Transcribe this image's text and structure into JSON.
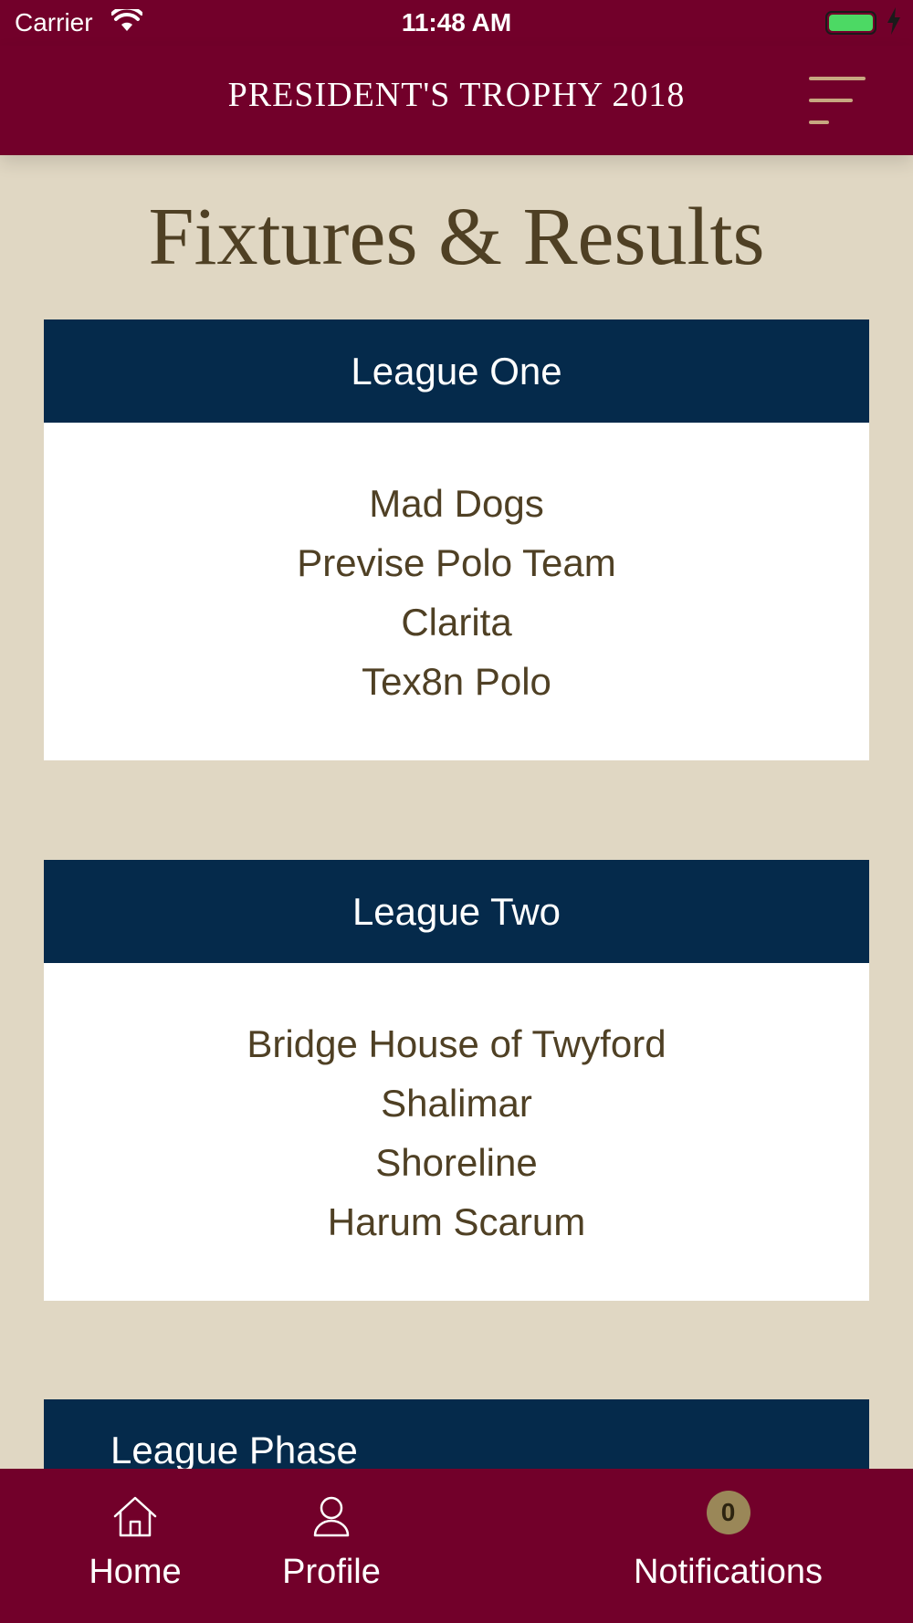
{
  "status_bar": {
    "carrier": "Carrier",
    "time": "11:48 AM",
    "battery_color": "#4cd964"
  },
  "header": {
    "title": "PRESIDENT'S TROPHY 2018",
    "menu_icon": "menu-icon",
    "background": "#72002a"
  },
  "page": {
    "title": "Fixtures & Results"
  },
  "leagues": [
    {
      "name": "League One",
      "teams": [
        "Mad Dogs",
        "Previse Polo Team",
        "Clarita",
        "Tex8n Polo"
      ]
    },
    {
      "name": "League Two",
      "teams": [
        "Bridge House of Twyford",
        "Shalimar",
        "Shoreline",
        "Harum Scarum"
      ]
    },
    {
      "name": "League Phase",
      "teams": []
    }
  ],
  "tab_bar": {
    "home": {
      "label": "Home",
      "icon": "home-icon"
    },
    "profile": {
      "label": "Profile",
      "icon": "user-icon"
    },
    "notifications": {
      "label": "Notifications",
      "badge": "0"
    }
  },
  "colors": {
    "accent": "#72002a",
    "league_header": "#052a4b",
    "background": "#e0d7c3",
    "text": "#4f4024"
  }
}
